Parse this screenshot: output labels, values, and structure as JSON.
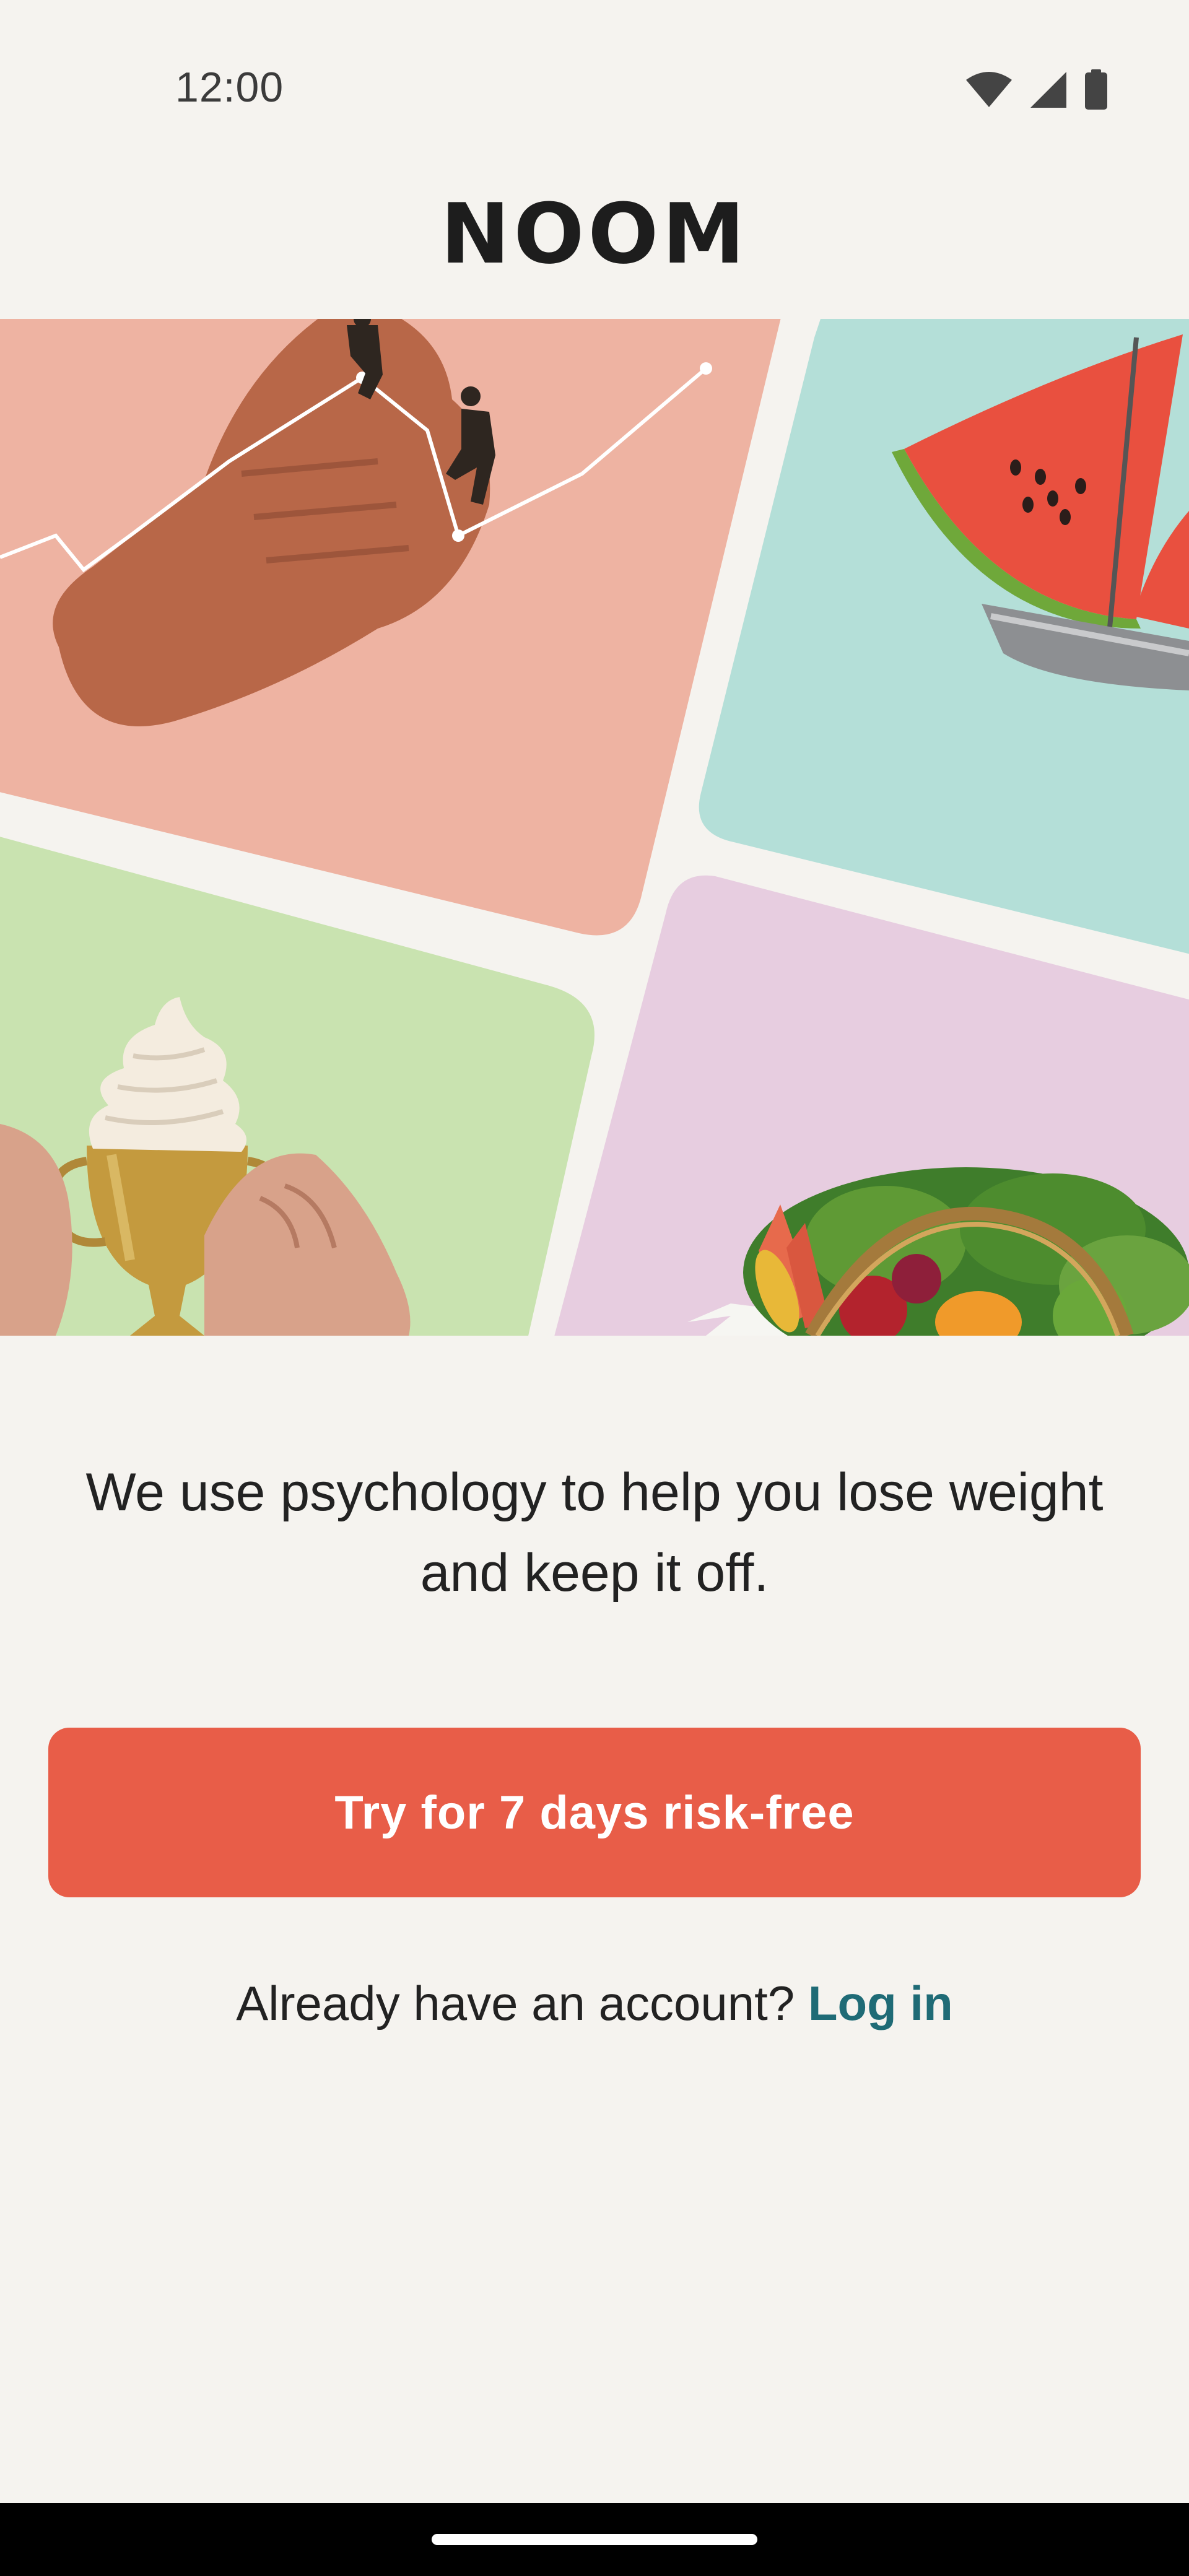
{
  "status_bar": {
    "time": "12:00",
    "icons": [
      "wifi-icon",
      "cell-signal-icon",
      "battery-icon"
    ]
  },
  "brand": {
    "logo_text": "NOOM"
  },
  "hero": {
    "panels": [
      {
        "name": "hand-climbers-panel",
        "color": "#eeb3a2"
      },
      {
        "name": "watermelon-sailboat-panel",
        "color": "#b4dfd8"
      },
      {
        "name": "ice-cream-trophy-panel",
        "color": "#c9e3b0"
      },
      {
        "name": "vegetable-basket-panel",
        "color": "#e7cde0"
      }
    ]
  },
  "main": {
    "tagline": "We use psychology to help you lose weight and keep it off.",
    "cta_label": "Try for 7 days risk-free",
    "login_prompt": "Already have an account?",
    "login_link": "Log in"
  },
  "colors": {
    "background": "#f5f3ef",
    "accent": "#e85d48",
    "link": "#1f6b76"
  }
}
